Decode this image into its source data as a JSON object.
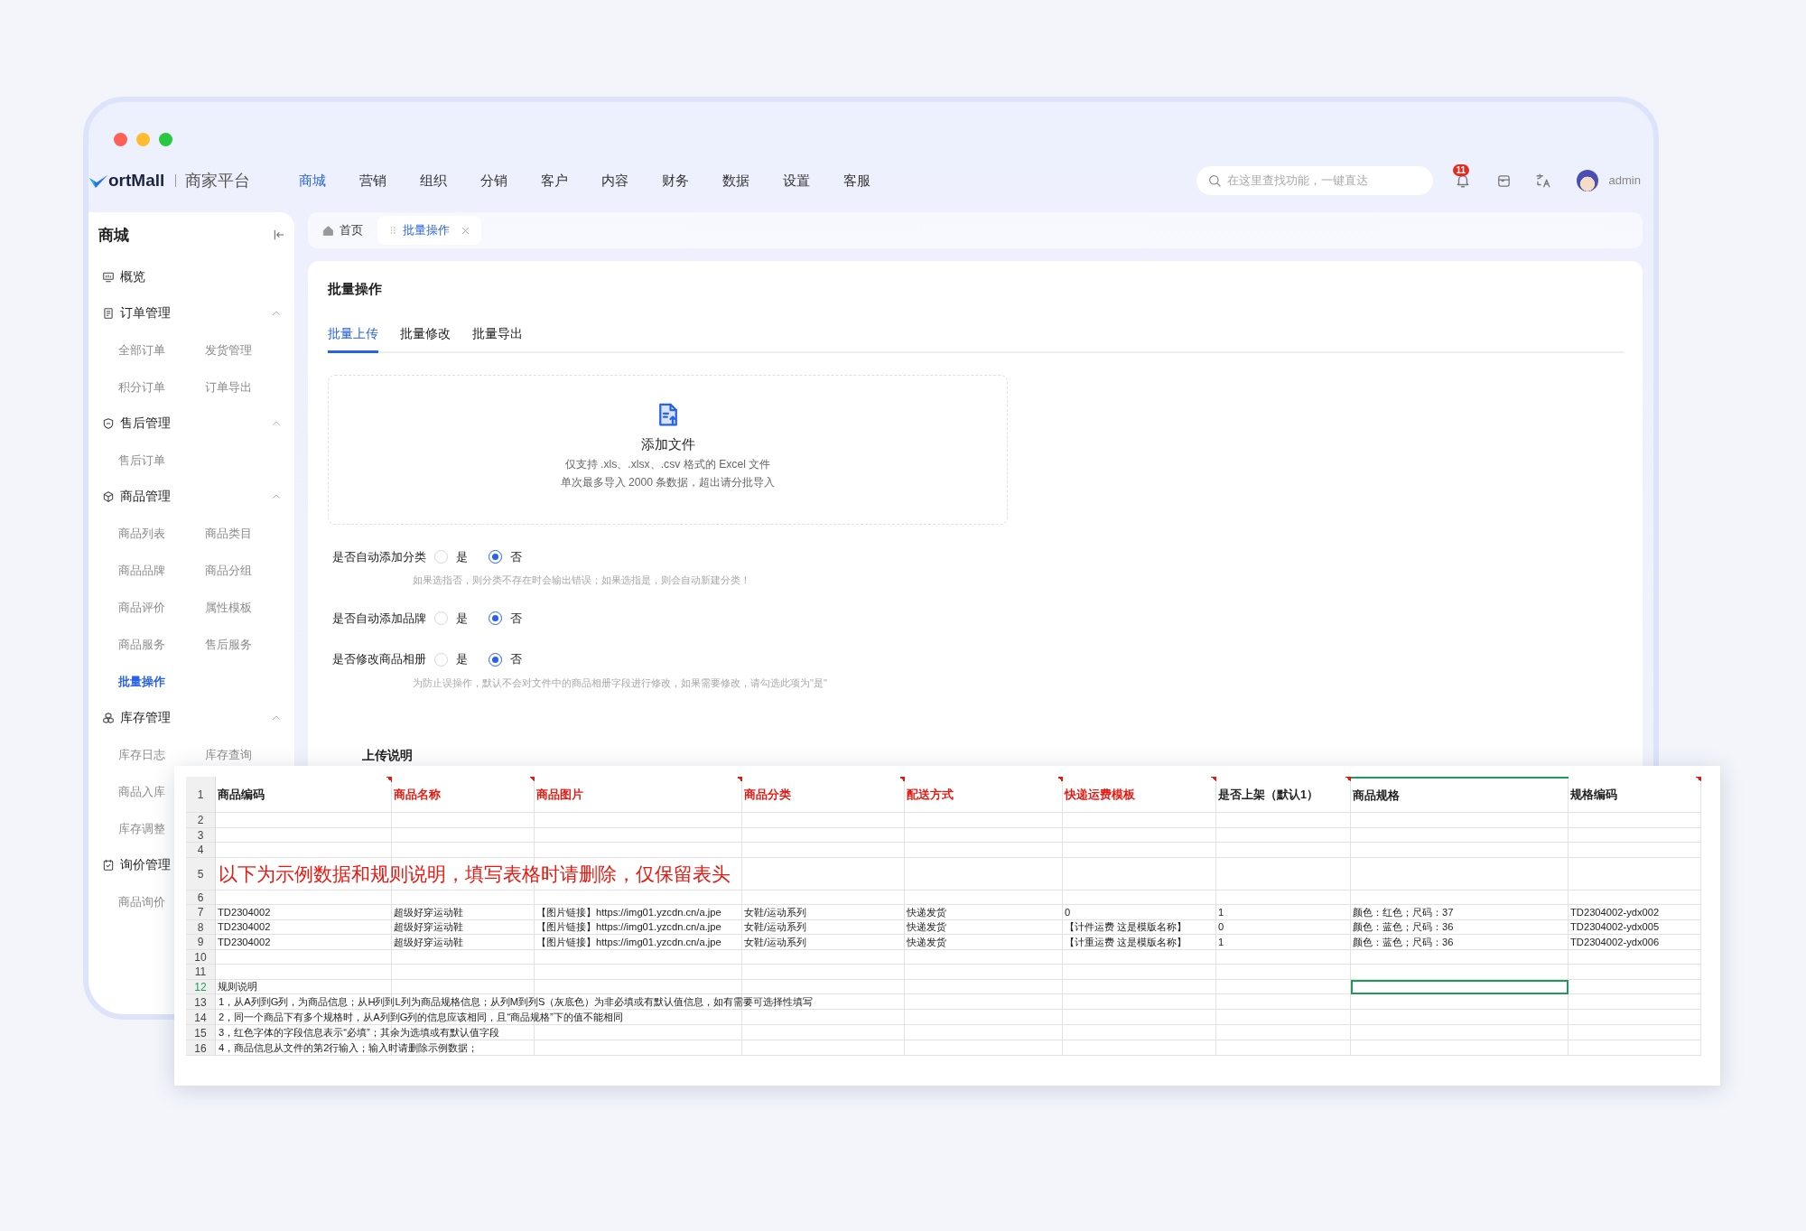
{
  "brand": {
    "name": "ortMall",
    "subtitle": "商家平台"
  },
  "top_nav": [
    {
      "label": "商城",
      "selected": true
    },
    {
      "label": "营销",
      "selected": false
    },
    {
      "label": "组织",
      "selected": false
    },
    {
      "label": "分销",
      "selected": false
    },
    {
      "label": "客户",
      "selected": false
    },
    {
      "label": "内容",
      "selected": false
    },
    {
      "label": "财务",
      "selected": false
    },
    {
      "label": "数据",
      "selected": false
    },
    {
      "label": "设置",
      "selected": false
    },
    {
      "label": "客服",
      "selected": false
    }
  ],
  "search": {
    "placeholder": "在这里查找功能，一键直达"
  },
  "notifications": {
    "badge": "11"
  },
  "user": {
    "name": "admin"
  },
  "sidebar": {
    "title": "商城",
    "groups": [
      {
        "label": "概览"
      },
      {
        "label": "订单管理",
        "expanded": true,
        "rows": [
          [
            {
              "label": "全部订单",
              "selected": false
            },
            {
              "label": "发货管理",
              "selected": false
            }
          ],
          [
            {
              "label": "积分订单",
              "selected": false
            },
            {
              "label": "订单导出",
              "selected": false
            }
          ]
        ]
      },
      {
        "label": "售后管理",
        "expanded": true,
        "rows": [
          [
            {
              "label": "售后订单",
              "selected": false
            }
          ]
        ]
      },
      {
        "label": "商品管理",
        "expanded": true,
        "rows": [
          [
            {
              "label": "商品列表",
              "selected": false
            },
            {
              "label": "商品类目",
              "selected": false
            }
          ],
          [
            {
              "label": "商品品牌",
              "selected": false
            },
            {
              "label": "商品分组",
              "selected": false
            }
          ],
          [
            {
              "label": "商品评价",
              "selected": false
            },
            {
              "label": "属性模板",
              "selected": false
            }
          ],
          [
            {
              "label": "商品服务",
              "selected": false
            },
            {
              "label": "售后服务",
              "selected": false
            }
          ],
          [
            {
              "label": "批量操作",
              "selected": true
            }
          ]
        ]
      },
      {
        "label": "库存管理",
        "expanded": true,
        "rows": [
          [
            {
              "label": "库存日志",
              "selected": false
            },
            {
              "label": "库存查询",
              "selected": false
            }
          ],
          [
            {
              "label": "商品入库",
              "selected": false
            }
          ],
          [
            {
              "label": "库存调整",
              "selected": false
            }
          ]
        ]
      },
      {
        "label": "询价管理",
        "rows": [
          [
            {
              "label": "商品询价",
              "selected": false
            }
          ]
        ]
      }
    ]
  },
  "page_tabs": [
    {
      "label": "首页",
      "kind": "home",
      "selected": false
    },
    {
      "label": "批量操作",
      "kind": "page",
      "selected": true
    }
  ],
  "page": {
    "title": "批量操作",
    "tabs": [
      {
        "label": "批量上传",
        "selected": true
      },
      {
        "label": "批量修改",
        "selected": false
      },
      {
        "label": "批量导出",
        "selected": false
      }
    ],
    "upload": {
      "title": "添加文件",
      "lines": [
        "仅支持 .xls、.xlsx、.csv 格式的 Excel 文件",
        "单次最多导入 2000 条数据，超出请分批导入"
      ]
    },
    "options": [
      {
        "label": "是否自动添加分类",
        "choices": [
          {
            "label": "是",
            "selected": false
          },
          {
            "label": "否",
            "selected": true
          }
        ],
        "hint": "如果选指否，则分类不存在时会输出错误；如果选指是，则会自动新建分类！"
      },
      {
        "label": "是否自动添加品牌",
        "choices": [
          {
            "label": "是",
            "selected": false
          },
          {
            "label": "否",
            "selected": true
          }
        ]
      },
      {
        "label": "是否修改商品相册",
        "choices": [
          {
            "label": "是",
            "selected": false
          },
          {
            "label": "否",
            "selected": true
          }
        ],
        "hint": "为防止误操作，默认不会对文件中的商品相册字段进行修改，如果需要修改，请勾选此项为\"是\""
      }
    ],
    "section_title": "上传说明"
  },
  "spreadsheet": {
    "columns": [
      {
        "label": "商品编码",
        "required": false,
        "comment": true,
        "selected": false
      },
      {
        "label": "商品名称",
        "required": true,
        "comment": true,
        "selected": false
      },
      {
        "label": "商品图片",
        "required": true,
        "comment": true,
        "selected": false
      },
      {
        "label": "商品分类",
        "required": true,
        "comment": true,
        "selected": false
      },
      {
        "label": "配送方式",
        "required": true,
        "comment": true,
        "selected": false
      },
      {
        "label": "快递运费模板",
        "required": true,
        "comment": true,
        "selected": false
      },
      {
        "label": "是否上架（默认1）",
        "required": false,
        "comment": true,
        "selected": false
      },
      {
        "label": "商品规格",
        "required": false,
        "comment": false,
        "selected": true
      },
      {
        "label": "规格编码",
        "required": false,
        "comment": true,
        "selected": false
      }
    ],
    "rows": [
      {
        "number": "1",
        "kind": "header",
        "selected": false
      },
      {
        "number": "2",
        "kind": "blank",
        "selected": false
      },
      {
        "number": "3",
        "kind": "blank",
        "selected": false
      },
      {
        "number": "4",
        "kind": "blank",
        "selected": false
      },
      {
        "number": "5",
        "kind": "banner",
        "selected": false,
        "text": "以下为示例数据和规则说明，填写表格时请删除，仅保留表头"
      },
      {
        "number": "6",
        "kind": "blank",
        "selected": false
      },
      {
        "number": "7",
        "kind": "data",
        "selected": false,
        "cells": [
          "TD2304002",
          "超级好穿运动鞋",
          "【图片链接】https://img01.yzcdn.cn/a.jpe",
          "女鞋/运动系列",
          "快递发货",
          "0",
          "1",
          "颜色：红色；尺码：37",
          "TD2304002-ydx002"
        ]
      },
      {
        "number": "8",
        "kind": "data",
        "selected": false,
        "cells": [
          "TD2304002",
          "超级好穿运动鞋",
          "【图片链接】https://img01.yzcdn.cn/a.jpe",
          "女鞋/运动系列",
          "快递发货",
          "【计件运费 这是模版名称】",
          "0",
          "颜色：蓝色；尺码：36",
          "TD2304002-ydx005"
        ]
      },
      {
        "number": "9",
        "kind": "data",
        "selected": false,
        "cells": [
          "TD2304002",
          "超级好穿运动鞋",
          "【图片链接】https://img01.yzcdn.cn/a.jpe",
          "女鞋/运动系列",
          "快递发货",
          "【计重运费 这是模版名称】",
          "1",
          "颜色：蓝色；尺码：36",
          "TD2304002-ydx006"
        ]
      },
      {
        "number": "10",
        "kind": "blank",
        "selected": false
      },
      {
        "number": "11",
        "kind": "blank",
        "selected": false
      },
      {
        "number": "12",
        "kind": "data",
        "selected": true,
        "cells": [
          "规则说明"
        ]
      },
      {
        "number": "13",
        "kind": "note",
        "selected": false,
        "text": "1，从A列到G列，为商品信息；从H列到L列为商品规格信息；从列M到列S（灰底色）为非必填或有默认值信息，如有需要可选择性填写"
      },
      {
        "number": "14",
        "kind": "note",
        "selected": false,
        "text": "2，同一个商品下有多个规格时，从A列到G列的信息应该相同，且“商品规格”下的值不能相同"
      },
      {
        "number": "15",
        "kind": "note",
        "selected": false,
        "text": "3，红色字体的字段信息表示“必填”；其余为选填或有默认值字段"
      },
      {
        "number": "16",
        "kind": "note",
        "selected": false,
        "text": "4，商品信息从文件的第2行输入；输入时请删除示例数据；"
      }
    ]
  }
}
